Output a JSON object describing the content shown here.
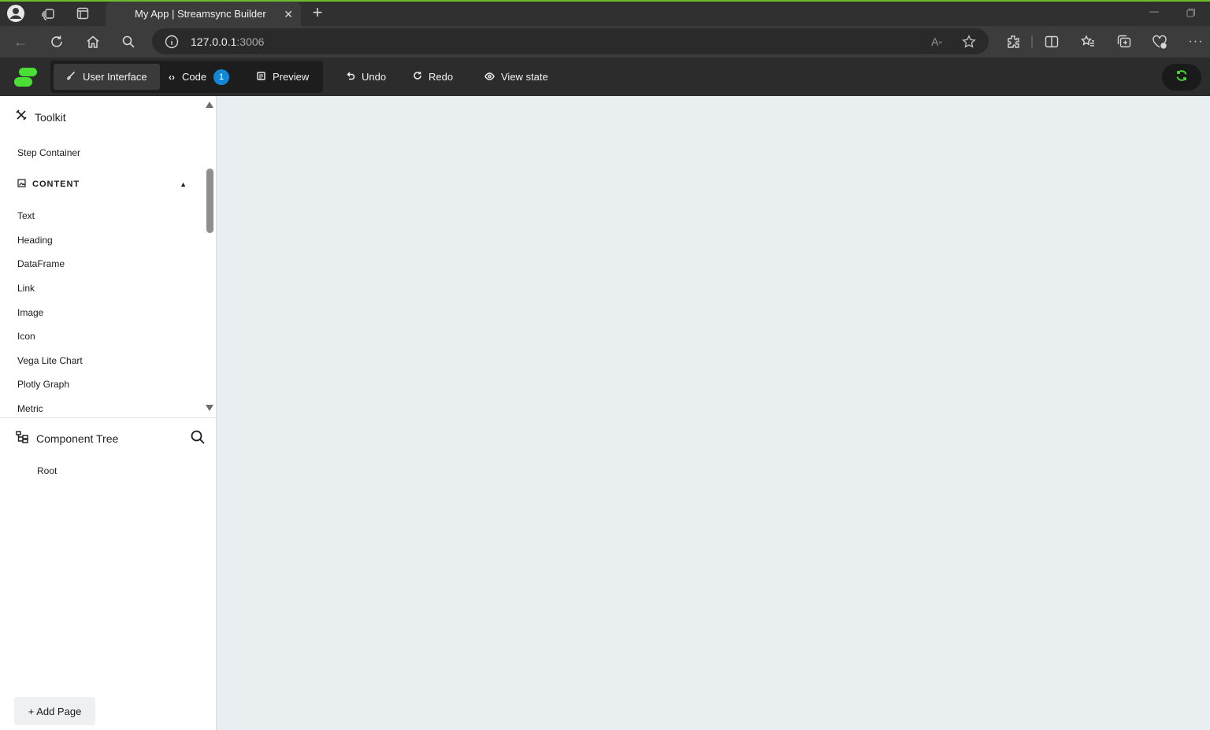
{
  "browser": {
    "tab_title": "My App | Streamsync Builder",
    "url_host": "127.0.0.1",
    "url_port": ":3006"
  },
  "header": {
    "modes": [
      {
        "label": "User Interface",
        "active": true
      },
      {
        "label": "Code",
        "badge": "1"
      },
      {
        "label": "Preview"
      }
    ],
    "undo_label": "Undo",
    "redo_label": "Redo",
    "view_state_label": "View state",
    "sync_color": "#4ade36"
  },
  "toolkit": {
    "title": "Toolkit",
    "items_above": [
      "Step Container"
    ],
    "category": "CONTENT",
    "items": [
      "Text",
      "Heading",
      "DataFrame",
      "Link",
      "Image",
      "Icon",
      "Vega Lite Chart",
      "Plotly Graph",
      "Metric"
    ]
  },
  "tree": {
    "title": "Component Tree",
    "root_label": "Root"
  },
  "add_page_label": "+ Add Page",
  "colors": {
    "accent": "#4ade36",
    "badge": "#1387d6",
    "canvas": "#e9eef1"
  }
}
